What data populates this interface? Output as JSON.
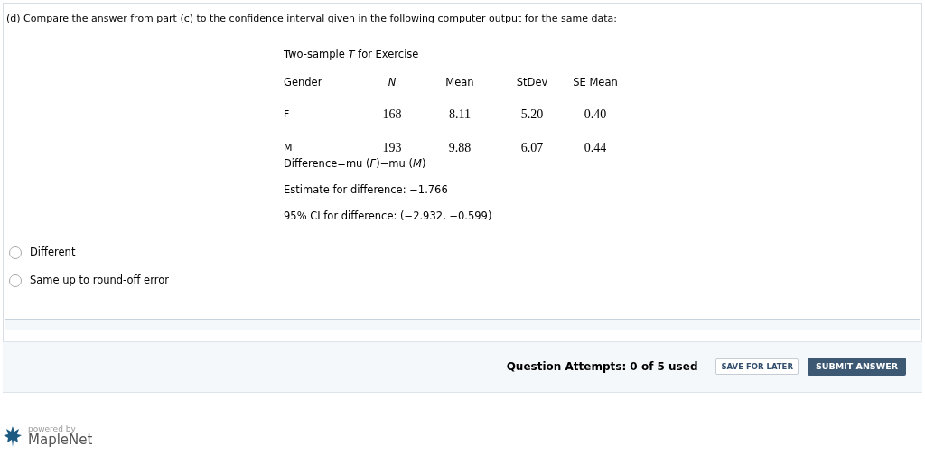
{
  "question": {
    "prompt": "(d) Compare the answer from part (c) to the confidence interval given in the following computer output for the same data:"
  },
  "output": {
    "title": "Two-sample *T* for Exercise",
    "columns": [
      "Gender",
      "*N*",
      "Mean",
      "StDev",
      "SE Mean"
    ],
    "rows": [
      [
        "F",
        "168",
        "8.11",
        "5.20",
        "0.40"
      ],
      [
        "M",
        "193",
        "9.88",
        "6.07",
        "0.44"
      ]
    ],
    "lines": [
      "Difference=mu (*F*)−mu (*M*)",
      "Estimate for difference: −1.766",
      "95% CI for difference: (−2.932, −0.599)"
    ]
  },
  "choices": [
    {
      "label": "Different",
      "selected": false
    },
    {
      "label": "Same up to round-off error",
      "selected": false
    }
  ],
  "footer": {
    "attempts": "Question Attempts: 0 of 5 used",
    "save": "SAVE FOR LATER",
    "submit": "SUBMIT ANSWER"
  },
  "branding": {
    "powered": "powered by",
    "name": "MapleNet"
  }
}
